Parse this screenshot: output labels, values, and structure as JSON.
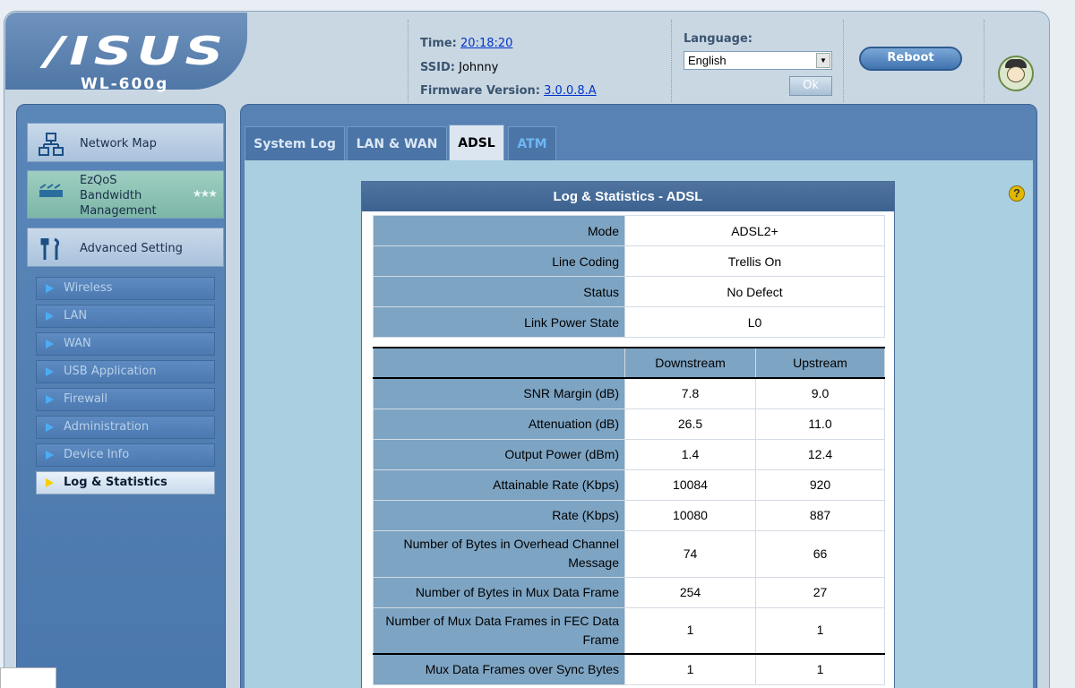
{
  "header": {
    "brand": "/ISUS",
    "model": "WL-600g",
    "time_label": "Time:",
    "time_value": "20:18:20",
    "ssid_label": "SSID:",
    "ssid_value": "Johnny",
    "firmware_label": "Firmware Version:",
    "firmware_value": "3.0.0.8.A",
    "language_label": "Language:",
    "language_value": "English",
    "ok_label": "Ok",
    "reboot_label": "Reboot"
  },
  "sidebar": {
    "main": [
      {
        "label": "Network Map",
        "icon": "network-map-icon"
      },
      {
        "label": "EzQoS\nBandwidth\nManagement",
        "icon": "ezqos-icon"
      },
      {
        "label": "Advanced Setting",
        "icon": "tools-icon"
      }
    ],
    "sub": [
      "Wireless",
      "LAN",
      "WAN",
      "USB Application",
      "Firewall",
      "Administration",
      "Device Info",
      "Log & Statistics"
    ],
    "active": "Log & Statistics"
  },
  "tabs": [
    "System Log",
    "LAN & WAN",
    "ADSL",
    "ATM"
  ],
  "active_tab": "ADSL",
  "panel_title": "Log & Statistics - ADSL",
  "status_rows": [
    {
      "label": "Mode",
      "value": "ADSL2+"
    },
    {
      "label": "Line Coding",
      "value": "Trellis On"
    },
    {
      "label": "Status",
      "value": "No Defect"
    },
    {
      "label": "Link Power State",
      "value": "L0"
    }
  ],
  "stats_header": {
    "downstream": "Downstream",
    "upstream": "Upstream"
  },
  "stats_rows": [
    {
      "label": "SNR Margin (dB)",
      "down": "7.8",
      "up": "9.0"
    },
    {
      "label": "Attenuation (dB)",
      "down": "26.5",
      "up": "11.0"
    },
    {
      "label": "Output Power (dBm)",
      "down": "1.4",
      "up": "12.4"
    },
    {
      "label": "Attainable Rate (Kbps)",
      "down": "10084",
      "up": "920"
    },
    {
      "label": "Rate (Kbps)",
      "down": "10080",
      "up": "887"
    },
    {
      "label": "Number of Bytes in Overhead Channel Message",
      "down": "74",
      "up": "66"
    },
    {
      "label": "Number of Bytes in Mux Data Frame",
      "down": "254",
      "up": "27"
    },
    {
      "label": "Number of Mux Data Frames in FEC Data Frame",
      "down": "1",
      "up": "1"
    },
    {
      "label": "Mux Data Frames over Sync Bytes",
      "down": "1",
      "up": "1"
    }
  ],
  "colors": {
    "panel_blue": "#5881b4",
    "content_bg": "#a9cfe0",
    "label_cell": "#7da4c3"
  }
}
